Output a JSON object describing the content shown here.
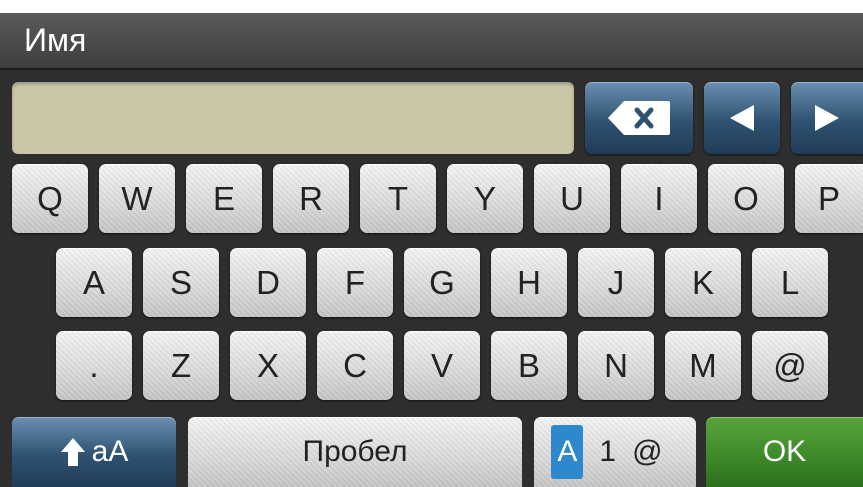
{
  "header": {
    "title": "Имя"
  },
  "input": {
    "value": ""
  },
  "controls": {
    "backspace_icon": "backspace-icon",
    "left_icon": "arrow-left-icon",
    "right_icon": "arrow-right-icon"
  },
  "keyboard": {
    "row1": [
      "Q",
      "W",
      "E",
      "R",
      "T",
      "Y",
      "U",
      "I",
      "O",
      "P"
    ],
    "row2": [
      "A",
      "S",
      "D",
      "F",
      "G",
      "H",
      "J",
      "K",
      "L"
    ],
    "row3": [
      ".",
      "Z",
      "X",
      "C",
      "V",
      "B",
      "N",
      "M",
      "@"
    ]
  },
  "bottom": {
    "shift_label": "aA",
    "space_label": "Пробел",
    "mode_letters": "A",
    "mode_numbers": "1",
    "mode_symbols": "@",
    "ok_label": "OK"
  },
  "colors": {
    "accent_blue": "#2f88cc",
    "ok_green": "#3e8a2a",
    "input_bg": "#cac7a6"
  }
}
